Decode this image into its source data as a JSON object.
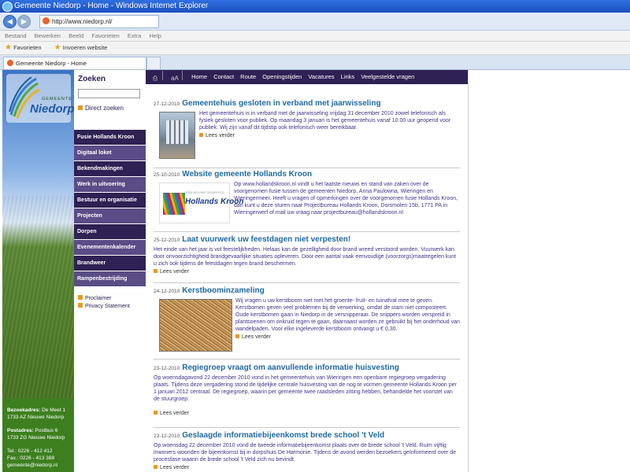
{
  "window": {
    "title": "Gemeente Niedorp - Home - Windows Internet Explorer"
  },
  "browser": {
    "address": "http://www.niedorp.nl/",
    "menu": [
      "Bestand",
      "Bewerken",
      "Beeld",
      "Favorieten",
      "Extra",
      "Help"
    ],
    "favorites_label": "Favorieten",
    "invoeren_label": "Invoeren website",
    "tab_title": "Gemeente Niedorp - Home"
  },
  "logo": {
    "gemeente": "GEMEENTE",
    "name": "Niedorp"
  },
  "search": {
    "title": "Zoeken",
    "direct_link": "Direct zoeken"
  },
  "sidebar": {
    "items": [
      "Fusie Hollands Kroon",
      "Digitaal loket",
      "Bekendmakingen",
      "Werk in uitvoering",
      "Bestuur en organisatie",
      "Projecten",
      "Dorpen",
      "Evenementenkalender",
      "Brandweer",
      "Rampenbestrijding"
    ],
    "footer_links": [
      "Proclaimer",
      "Privacy Statement"
    ]
  },
  "contact": {
    "bezoek_label": "Bezoekadres:",
    "bezoek_line1": "De Meet 1",
    "bezoek_line2": "1733 AZ Nieuwe Niedorp",
    "post_label": "Postadres:",
    "post_line1": "Postbus 6",
    "post_line2": "1733 ZG Nieuwe Niedorp",
    "tel": "Tel.: 0226 - 412 412",
    "fax": "Fax.: 0226 - 413 388",
    "email": "gemeente@niedorp.nl"
  },
  "topnav": {
    "icons": [
      "print-icon",
      "font-size-icon"
    ],
    "links": [
      "Home",
      "Contact",
      "Route",
      "Openingstijden",
      "Vacatures",
      "Links",
      "Veelgestelde vragen"
    ]
  },
  "news": [
    {
      "date": "27-12-2010",
      "title": "Gemeentehuis gesloten in verband met jaarwisseling",
      "body": "Het gemeentehuis is in verband met de jaarwisseling vrijdag 31 december 2010 zowel telefonisch als fysiek gesloten voor publiek.   Op maandag 3 januari is het gemeentehuis vanaf 10.00 uur geopend voor publiek. Wij zijn vanaf dit tijdstip ook telefonisch weer bereikbaar.",
      "more": "Lees verder"
    },
    {
      "date": "25-10-2010",
      "title": "Website gemeente Hollands Kroon",
      "body": "Op www.hollandskroon.nl vindt u het laatste nieuws en stand van zaken over de voorgenomen fusie tussen de gemeenten Niedorp, Anna Paulowna, Wieringen en Wieringermeer. Heeft u vragen of opmerkingen over de voorgenomen fusie Hollands Kroon, dan kunt u deze sturen naar Projectbureau Hollands Kroon, Dorsmolen 15b, 1771 PA in Wieringerwerf of mail uw vraag naar projectbureau@hollandskroon.nl",
      "image_text": "Hollands Kroon",
      "image_small": "EEN NIEUWE GEMEENTE"
    },
    {
      "date": "25-12-2010",
      "title": "Laat vuurwerk uw feestdagen niet verpesten!",
      "body": "Het einde van het jaar is vol feestelijkheden. Helaas kan de gezelligheid door brand wreed verstoord worden. Vuurwerk kan door onvoorzichtigheid brandgevaarlijke situaties opleveren. Door een aantal vaak eenvoudige (voorzorgs)maatregelen kunt u zich ook tijdens de feestdagen tegen brand beschermen.",
      "more": "Lees verder"
    },
    {
      "date": "24-12-2010",
      "title": "Kerstboominzameling",
      "body": "Wij vragen u uw kerstboom niet met het groente- fruit- en tuinafval mee te geven. Kerstbomen geven veel problemen bij de verwerking, omdat de stam niet composteert. Oude kerstbomen gaan in Niedorp in de versnipperaar. De snippers worden verspreid in plantsoenen om onkruid tegen te gaan, daarnaast worden ze gebruikt bij het onderhoud van wandelpaden. Voor elke ingeleverde kerstboom ontvangt u € 0,30.",
      "more": "Lees verder"
    },
    {
      "date": "23-12-2010",
      "title": "Regiegroep vraagt om aanvullende informatie huisvesting",
      "body": "Op woensdagavond 22 december 2010 vond in het gemeentehuis van Wieringen een openbare regiegroep vergadering plaats. Tijdens deze vergadering stond de tijdelijke centrale huisvesting van de nog te vormen gemeente Hollands Kroon per 1 januari 2012 centraal. De regiegroep, waarin per gemeente twee raadsleden zitting hebben, behandelde het voorstel van de stuurgroep.",
      "more": "Lees verder"
    },
    {
      "date": "23-12-2010",
      "title": "Geslaagde informatiebijeenkomst brede school 't Veld",
      "body": "Op woensdag 22 december 2010 vond de tweede informatiebijeenkomst plaats over de brede school 't Veld. Ruim vijftig inwoners woonden de bijeenkomst bij in dorpshuis De Harmonie. Tijdens de avond werden bezoekers geïnformeerd over de procesfase waarin de brede school 't Veld zich nu bevindt.",
      "more": "Lees verder"
    }
  ]
}
